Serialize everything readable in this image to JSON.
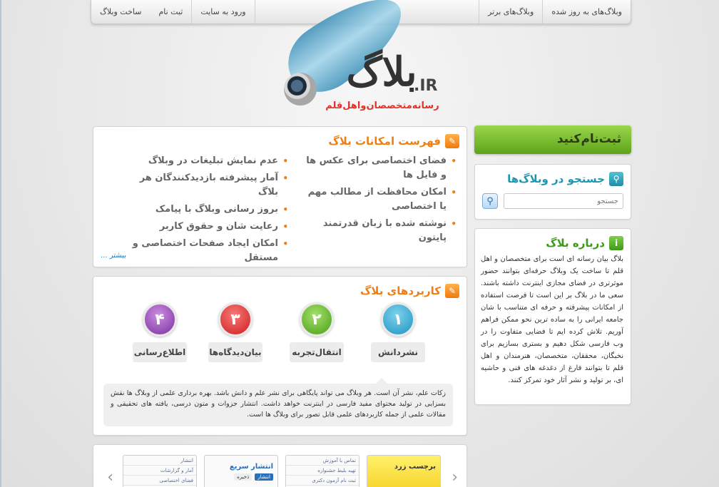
{
  "nav": {
    "right_items": [
      "وبلاگ‌های به روز شده",
      "وبلاگ‌های برتر"
    ],
    "left_items": [
      "ساخت وبلاگ",
      "ثبت نام",
      "ورود به سایت"
    ]
  },
  "logo": {
    "text": "بلاگ",
    "domain": ".IR",
    "tagline": "رسانه‌متخصصان‌واهل‌قلم"
  },
  "features": {
    "title": "فهرست امکانات بلاگ",
    "right_col": [
      "فضای اختصاصی برای عکس ها و فایل ها",
      "امکان محافظت از مطالب مهم یا اختصاصی",
      "نوشته شده با زبان قدرتمند پایتون"
    ],
    "left_col": [
      "عدم نمایش تبلیغات در وبلاگ",
      "آمار پیشرفته بازدیدکنندگان هر بلاگ",
      "بروز رسانی وبلاگ با پیامک",
      "رعایت شان و حقوق کاربر",
      "امکان ایجاد صفحات اختصاصی و مستقل"
    ],
    "more": "بیشتر ..."
  },
  "usages": {
    "title": "کاربردهای بلاگ",
    "items": [
      {
        "num": "۱",
        "label": "نشردانش"
      },
      {
        "num": "۲",
        "label": "انتقال‌تجربه"
      },
      {
        "num": "۳",
        "label": "بیان‌دیدگاه‌ها"
      },
      {
        "num": "۴",
        "label": "اطلاع‌رسانی"
      }
    ],
    "description": "زکات علم، نشر آن است. هر وبلاگ می تواند پایگاهی برای نشر علم و دانش باشد. بهره برداری علمی از وبلاگ ها نقش بسزایی در تولید محتوای مفید فارسی در اینترنت خواهد داشت. انتشار جزوات و متون درسی، یافته های تحقیقی و مقالات علمی از جمله کاربردهای علمی قابل تصور برای وبلاگ ها است."
  },
  "templates": {
    "thumb1_title": "برچسب زرد",
    "thumb2_rows": [
      "تماس با آموزش",
      "تهیه بلیط جشنواره",
      "ثبت نام آزمون دکتری"
    ],
    "thumb3_title": "انتشار سریع",
    "thumb3_buttons": [
      "انتشار",
      "ذخیره"
    ],
    "thumb4_rows": [
      "انتشار",
      "آمار و گزارشات",
      "فضای اختصاصی"
    ]
  },
  "sidebar": {
    "signup": "ثبت‌نام‌کنید",
    "search_title": "جستجو در وبلاگ‌ها",
    "search_placeholder": "جستجو",
    "about_title": "درباره بلاگ",
    "about_text": "بلاگ بیان رسانه ای است برای متخصصان و اهل قلم تا ساخت یک وبلاگ حرفه‌ای بتوانند حضور موثرتری در فضای مجازی اینترنت داشته باشند. سعی ما در بلاگ بر این است تا فرصت استفاده از امکانات پیشرفته و حرفه ای متناسب با شان جامعه ایرانی را به ساده ترین نحو ممکن فراهم آوریم. تلاش کرده ایم تا فضایی متفاوت را در وب فارسی شکل دهیم و بستری بسازیم برای نخبگان، محققان، متخصصان، هنرمندان و اهل قلم تا بتوانند فارغ از دغدغه های فنی و حاشیه ای، بر تولید و نشر آثار خود تمرکز کنند."
  },
  "colors": {
    "accent_orange": "#f07e12",
    "accent_teal": "#1a98b0",
    "accent_green": "#3d9a16",
    "link_blue": "#1f7fc4"
  }
}
